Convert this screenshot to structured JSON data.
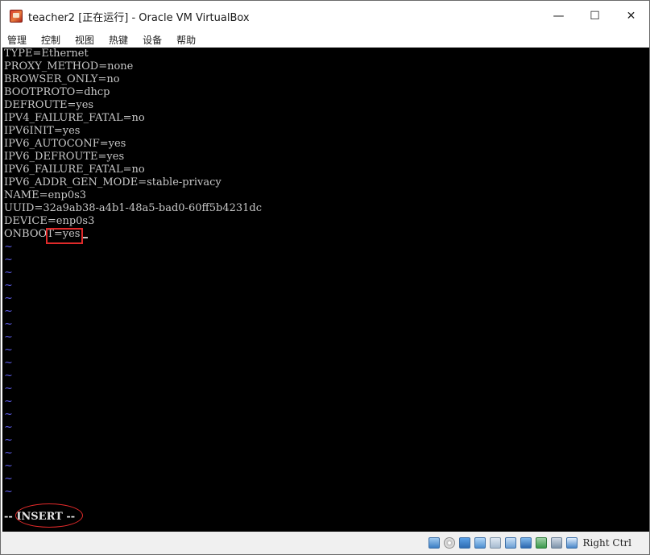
{
  "window": {
    "title": "teacher2 [正在运行] - Oracle VM VirtualBox",
    "controls": {
      "minimize": "—",
      "maximize": "☐",
      "close": "✕"
    }
  },
  "menu": [
    "管理",
    "控制",
    "视图",
    "热键",
    "设备",
    "帮助"
  ],
  "console": {
    "lines": [
      "TYPE=Ethernet",
      "PROXY_METHOD=none",
      "BROWSER_ONLY=no",
      "BOOTPROTO=dhcp",
      "DEFROUTE=yes",
      "IPV4_FAILURE_FATAL=no",
      "IPV6INIT=yes",
      "IPV6_AUTOCONF=yes",
      "IPV6_DEFROUTE=yes",
      "IPV6_FAILURE_FATAL=no",
      "IPV6_ADDR_GEN_MODE=stable-privacy",
      "NAME=enp0s3",
      "UUID=32a9ab38-a4b1-48a5-bad0-60ff5b4231dc",
      "DEVICE=enp0s3"
    ],
    "onboot_key": "ONBOOT=",
    "onboot_value": "yes",
    "tilde": "~",
    "mode": "-- INSERT --"
  },
  "statusbar": {
    "host_key": "Right Ctrl"
  },
  "colors": {
    "console_bg": "#000000",
    "console_text": "#c8c8c8",
    "tilde": "#5a5ae0",
    "annotation": "#e02a2a"
  }
}
